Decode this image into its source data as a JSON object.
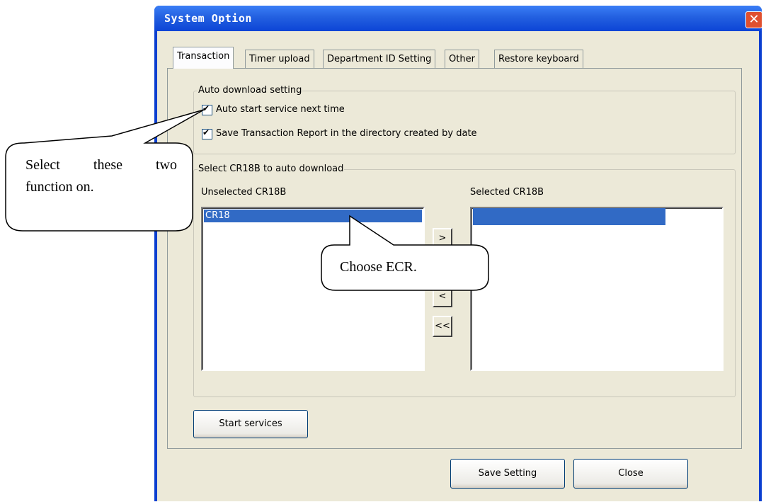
{
  "window": {
    "title": "System Option",
    "close_glyph": "✕"
  },
  "tabs": [
    {
      "label": "Transaction",
      "active": true
    },
    {
      "label": "Timer upload",
      "active": false
    },
    {
      "label": "Department ID Setting",
      "active": false
    },
    {
      "label": "Other",
      "active": false
    },
    {
      "label": "Restore keyboard",
      "active": false
    }
  ],
  "auto_download": {
    "group_label": "Auto download setting",
    "options": [
      {
        "label": "Auto start service next time",
        "checked": true
      },
      {
        "label": "Save Transaction Report in the directory created by date",
        "checked": true
      }
    ]
  },
  "select_cr": {
    "group_label": "Select CR18B to auto download",
    "unselected_label": "Unselected CR18B",
    "selected_label": "Selected CR18B",
    "unselected_items": [
      "CR18"
    ],
    "selected_items": [
      ""
    ],
    "move_buttons": [
      ">",
      ">>",
      "<",
      "<<"
    ]
  },
  "start_services_label": "Start services",
  "footer": {
    "save_label": "Save Setting",
    "close_label": "Close"
  },
  "callouts": {
    "left_line1": "Select these two",
    "left_line2": "function on.",
    "center": "Choose ECR."
  },
  "colors": {
    "titlebar": "#2360e0",
    "selection": "#316ac5",
    "window_bg": "#ece9d8"
  }
}
